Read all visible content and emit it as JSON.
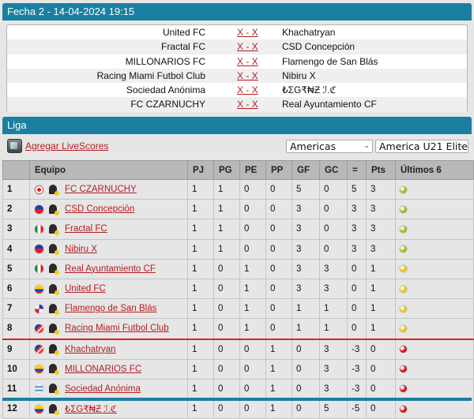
{
  "header": {
    "title": "Fecha 2 - 14-04-2024 19:15"
  },
  "matches": [
    {
      "home": "United FC",
      "score": "X - X",
      "away": "Khachatryan"
    },
    {
      "home": "Fractal FC",
      "score": "X - X",
      "away": "CSD Concepción"
    },
    {
      "home": "MILLONARIOS FC",
      "score": "X - X",
      "away": "Flamengo de San Blás"
    },
    {
      "home": "Racing Miami Futbol Club",
      "score": "X - X",
      "away": "Nibiru X"
    },
    {
      "home": "Sociedad Anónima",
      "score": "X - X",
      "away": "₺ΣG₹₦Ƶ ℐ.ℭ"
    },
    {
      "home": "FC CZARNUCHY",
      "score": "X - X",
      "away": "Real Ayuntamiento CF"
    }
  ],
  "liga": {
    "title": "Liga",
    "livescores_label": "Agregar LiveScores",
    "region_select": "Americas",
    "league_select": "America U21 Elite",
    "columns": [
      "",
      "Equipo",
      "PJ",
      "PG",
      "PE",
      "PP",
      "GF",
      "GC",
      "=",
      "Pts",
      "Últimos 6"
    ],
    "rows": [
      {
        "pos": "1",
        "flag": "canada",
        "team": "FC CZARNUCHY",
        "pj": "1",
        "pg": "1",
        "pe": "0",
        "pp": "0",
        "gf": "5",
        "gc": "0",
        "diff": "5",
        "pts": "3",
        "last": "win"
      },
      {
        "pos": "2",
        "flag": "chile",
        "team": "CSD Concepción",
        "pj": "1",
        "pg": "1",
        "pe": "0",
        "pp": "0",
        "gf": "3",
        "gc": "0",
        "diff": "3",
        "pts": "3",
        "last": "win"
      },
      {
        "pos": "3",
        "flag": "mexico",
        "team": "Fractal FC",
        "pj": "1",
        "pg": "1",
        "pe": "0",
        "pp": "0",
        "gf": "3",
        "gc": "0",
        "diff": "3",
        "pts": "3",
        "last": "win"
      },
      {
        "pos": "4",
        "flag": "chile",
        "team": "Nibiru X",
        "pj": "1",
        "pg": "1",
        "pe": "0",
        "pp": "0",
        "gf": "3",
        "gc": "0",
        "diff": "3",
        "pts": "3",
        "last": "win"
      },
      {
        "pos": "5",
        "flag": "mexico",
        "team": "Real Ayuntamiento CF",
        "pj": "1",
        "pg": "0",
        "pe": "1",
        "pp": "0",
        "gf": "3",
        "gc": "3",
        "diff": "0",
        "pts": "1",
        "last": "draw"
      },
      {
        "pos": "6",
        "flag": "colombia",
        "team": "United FC",
        "pj": "1",
        "pg": "0",
        "pe": "1",
        "pp": "0",
        "gf": "3",
        "gc": "3",
        "diff": "0",
        "pts": "1",
        "last": "draw"
      },
      {
        "pos": "7",
        "flag": "panama",
        "team": "Flamengo de San Blás",
        "pj": "1",
        "pg": "0",
        "pe": "1",
        "pp": "0",
        "gf": "1",
        "gc": "1",
        "diff": "0",
        "pts": "1",
        "last": "draw"
      },
      {
        "pos": "8",
        "flag": "usa",
        "team": "Racing Miami Futbol Club",
        "pj": "1",
        "pg": "0",
        "pe": "1",
        "pp": "0",
        "gf": "1",
        "gc": "1",
        "diff": "0",
        "pts": "1",
        "last": "draw"
      },
      {
        "pos": "9",
        "flag": "usa",
        "team": "Khachatryan",
        "pj": "1",
        "pg": "0",
        "pe": "0",
        "pp": "1",
        "gf": "0",
        "gc": "3",
        "diff": "-3",
        "pts": "0",
        "last": "loss"
      },
      {
        "pos": "10",
        "flag": "colombia",
        "team": "MILLONARIOS FC",
        "pj": "1",
        "pg": "0",
        "pe": "0",
        "pp": "1",
        "gf": "0",
        "gc": "3",
        "diff": "-3",
        "pts": "0",
        "last": "loss"
      },
      {
        "pos": "11",
        "flag": "uruguay",
        "team": "Sociedad Anónima",
        "pj": "1",
        "pg": "0",
        "pe": "0",
        "pp": "1",
        "gf": "0",
        "gc": "3",
        "diff": "-3",
        "pts": "0",
        "last": "loss"
      },
      {
        "pos": "12",
        "flag": "colombia",
        "team": "₺ΣG₹₦Ƶ ℐ.ℭ",
        "pj": "1",
        "pg": "0",
        "pe": "0",
        "pp": "1",
        "gf": "0",
        "gc": "5",
        "diff": "-5",
        "pts": "0",
        "last": "loss"
      }
    ]
  },
  "colors": {
    "header_bg": "#1a7fa0",
    "link": "#b21e23",
    "win": "#9bc21b",
    "draw": "#f0c419",
    "loss": "#d8161b",
    "cutoff_line": "#e02020"
  }
}
